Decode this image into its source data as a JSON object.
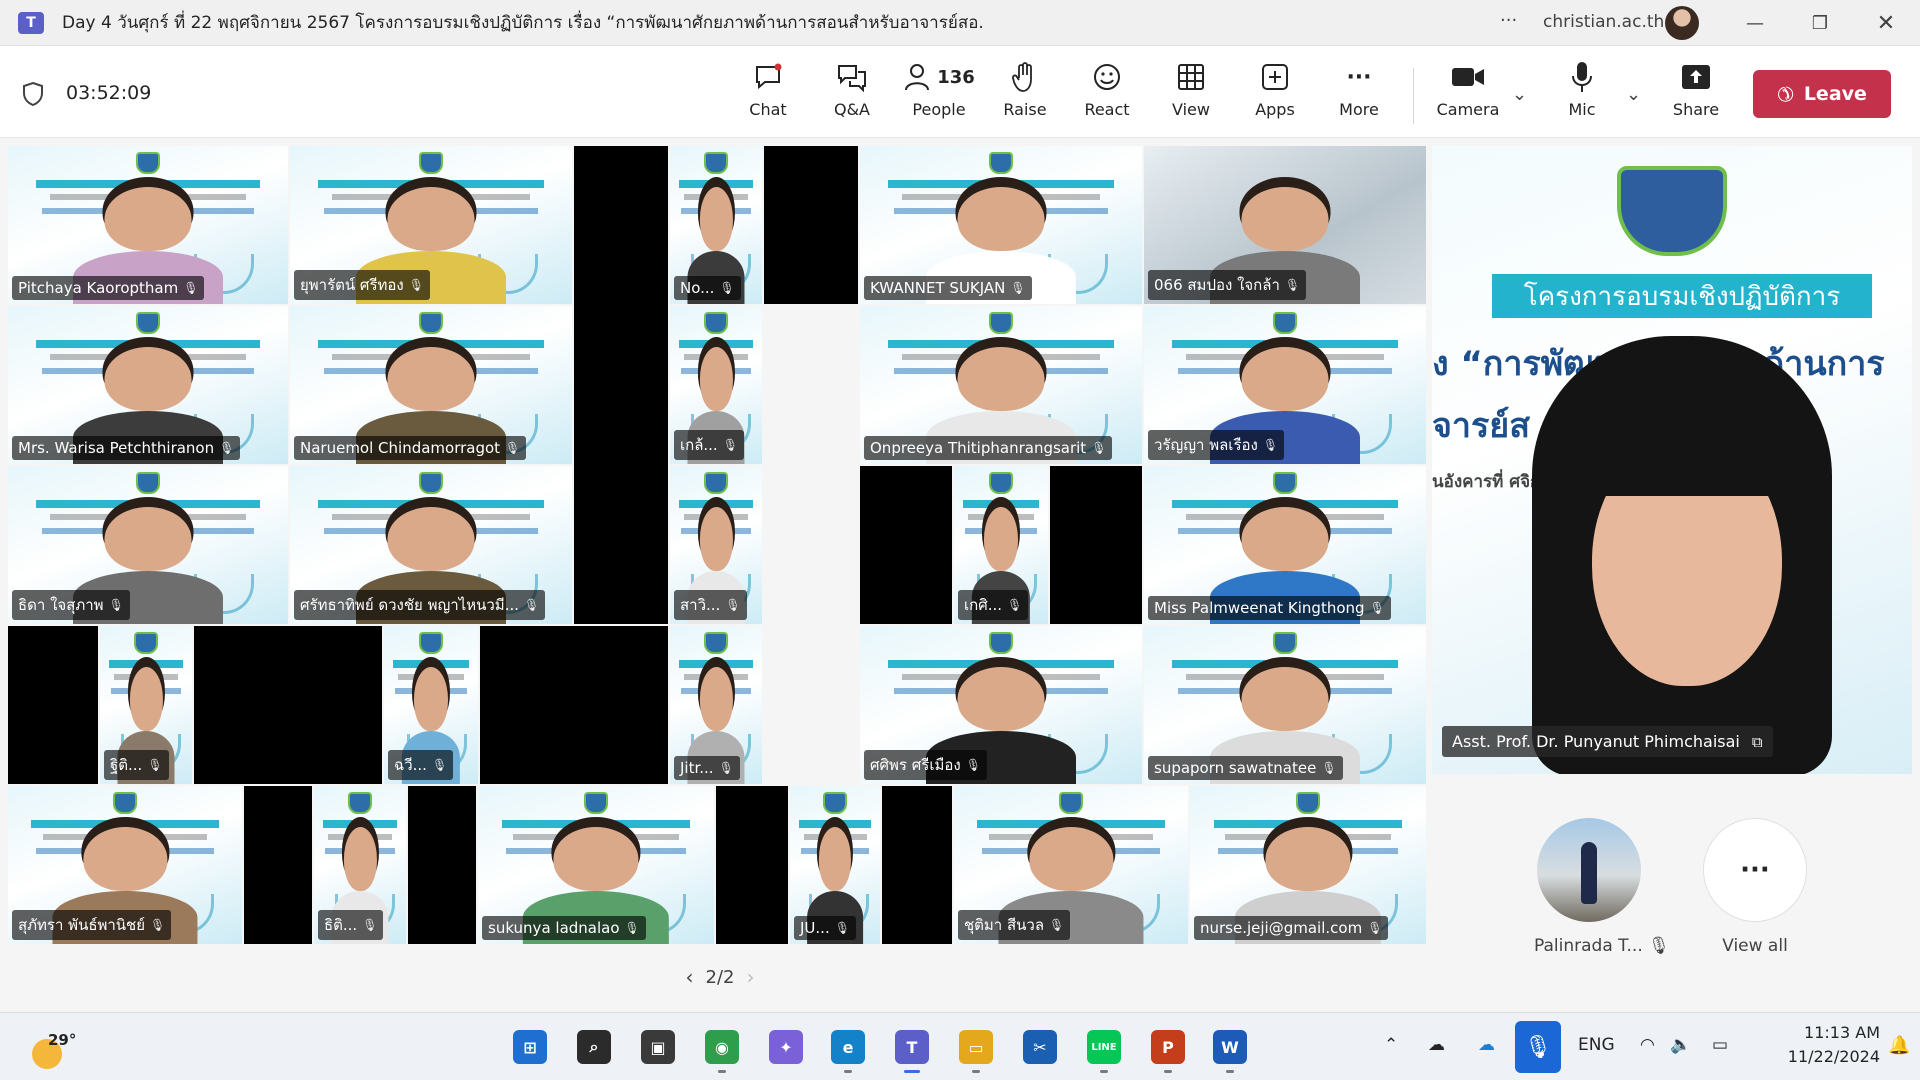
{
  "window": {
    "title": "Day 4 วันศุกร์ ที่ 22 พฤศจิกายน 2567 โครงการอบรมเชิงปฏิบัติการ เรื่อง “การพัฒนาศักยภาพด้านการสอนสำหรับอาจารย์สอ...",
    "more": "···",
    "account": "christian.ac.th",
    "logo": "T"
  },
  "toolbar": {
    "timer": "03:52:09",
    "chat": "Chat",
    "qa": "Q&A",
    "people": "People",
    "people_count": "136",
    "raise": "Raise",
    "react": "React",
    "view": "View",
    "apps": "Apps",
    "more": "More",
    "camera": "Camera",
    "mic": "Mic",
    "share": "Share",
    "leave": "Leave",
    "icons": {
      "chat": "chat-icon",
      "qa": "qa-icon",
      "people": "people-icon",
      "raise": "hand-icon",
      "react": "smiley-icon",
      "view": "grid-icon",
      "apps": "plus-square-icon",
      "more": "ellipsis-icon",
      "camera": "camera-icon",
      "mic": "microphone-icon",
      "share": "share-icon"
    }
  },
  "gallery": {
    "tiles": [
      {
        "name": "Pitchaya Kaoroptham"
      },
      {
        "name": "ยุพารัตน์ ศรีทอง"
      },
      {
        "name": "No..."
      },
      {
        "name": "KWANNET SUKJAN"
      },
      {
        "name": "066 สมปอง ใจกล้า"
      },
      {
        "name": "Mrs. Warisa Petchthiranon"
      },
      {
        "name": "Naruemol Chindamorragot"
      },
      {
        "name": "เกล้..."
      },
      {
        "name": "Onpreeya Thitiphanrangsarit"
      },
      {
        "name": "วรัญญา พลเรือง"
      },
      {
        "name": "ธิดา ใจสุภาพ"
      },
      {
        "name": "ศรัทธาทิพย์ ดวงชัย พญาไหนวมี..."
      },
      {
        "name": "สาวิ..."
      },
      {
        "name": "เกศิ..."
      },
      {
        "name": "Miss Palmweenat Kingthong"
      },
      {
        "name": "ฐิติ..."
      },
      {
        "name": "ฉวี..."
      },
      {
        "name": "Jitr..."
      },
      {
        "name": "ศศิพร ศรีเมือง"
      },
      {
        "name": "supaporn sawatnatee"
      },
      {
        "name": "สุภัทรา พันธ์พานิชย์"
      },
      {
        "name": "ธิติ..."
      },
      {
        "name": "sukunya ladnalao"
      },
      {
        "name": "JU..."
      },
      {
        "name": "ชุติมา สีนวล"
      },
      {
        "name": "nurse.jeji@gmail.com"
      }
    ]
  },
  "pager": {
    "label": "2/2",
    "prev": "‹",
    "next": "›"
  },
  "spotlight": {
    "name": "Asst. Prof. Dr. Punyanut Phimchaisai",
    "band_text": "โครงการอบรมเชิงปฏิบัติการ",
    "line1": "ง “การพัฒนาศักยภาพด้านการ",
    "line2": "จารย์ส                    การศึก",
    "line3": "นอังคารที่                              ศจิกายน 25"
  },
  "side": {
    "palinrada": "Palinrada T...",
    "view_all": "View all",
    "view_all_icon": "···"
  },
  "taskbar": {
    "temperature": "29°",
    "language": "ENG",
    "time": "11:13 AM",
    "date": "11/22/2024",
    "apps": [
      {
        "name": "windows-start",
        "label": "⊞",
        "color": "#1f6fd1"
      },
      {
        "name": "search",
        "label": "⌕",
        "color": "#2b2b2b"
      },
      {
        "name": "task-view",
        "label": "▣",
        "color": "#3a3a3a"
      },
      {
        "name": "chrome",
        "label": "◉",
        "color": "#2e9d4c"
      },
      {
        "name": "copilot",
        "label": "✦",
        "color": "#7b61d8"
      },
      {
        "name": "edge",
        "label": "e",
        "color": "#1482c9"
      },
      {
        "name": "teams",
        "label": "T",
        "color": "#5b5fc7"
      },
      {
        "name": "file-explorer",
        "label": "▭",
        "color": "#e3a81c"
      },
      {
        "name": "snipping-tool",
        "label": "✂",
        "color": "#1b5fb3"
      },
      {
        "name": "line",
        "label": "LINE",
        "color": "#06c755"
      },
      {
        "name": "powerpoint",
        "label": "P",
        "color": "#c43e1c"
      },
      {
        "name": "word",
        "label": "W",
        "color": "#1e5bb8"
      }
    ]
  },
  "colors": {
    "leave": "#c4314b",
    "teams": "#5b5fc7",
    "taskbar": "#eef1f6"
  }
}
